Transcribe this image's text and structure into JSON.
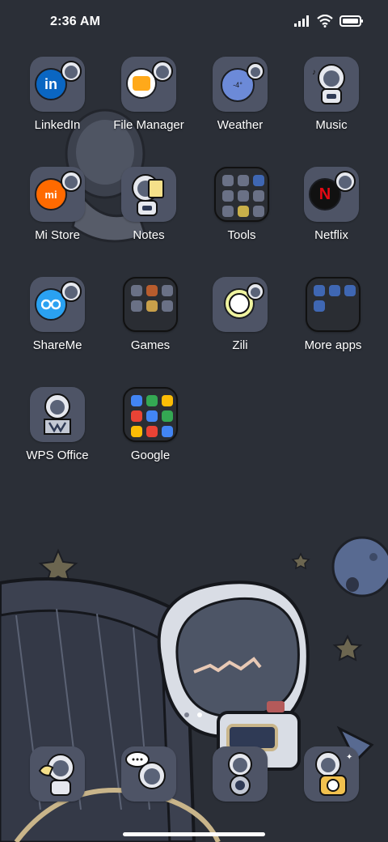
{
  "status_bar": {
    "time": "2:36 AM"
  },
  "apps": [
    {
      "label": "LinkedIn"
    },
    {
      "label": "File Manager"
    },
    {
      "label": "Weather",
      "temp": "-4°"
    },
    {
      "label": "Music"
    },
    {
      "label": "Mi Store",
      "logo": "mi"
    },
    {
      "label": "Notes"
    },
    {
      "label": "Tools"
    },
    {
      "label": "Netflix",
      "logo": "N"
    },
    {
      "label": "ShareMe"
    },
    {
      "label": "Games"
    },
    {
      "label": "Zili"
    },
    {
      "label": "More apps"
    },
    {
      "label": "WPS Office"
    },
    {
      "label": "Google"
    }
  ],
  "dock": [
    {
      "name": "phone"
    },
    {
      "name": "messages"
    },
    {
      "name": "browser"
    },
    {
      "name": "camera"
    }
  ],
  "colors": {
    "background": "#2b2f37",
    "tile": "#4e5466",
    "linkedin": "#0a66c2",
    "mi_orange": "#ff6a00",
    "netflix_red": "#e50914",
    "shareme_blue": "#2aa1f1"
  }
}
